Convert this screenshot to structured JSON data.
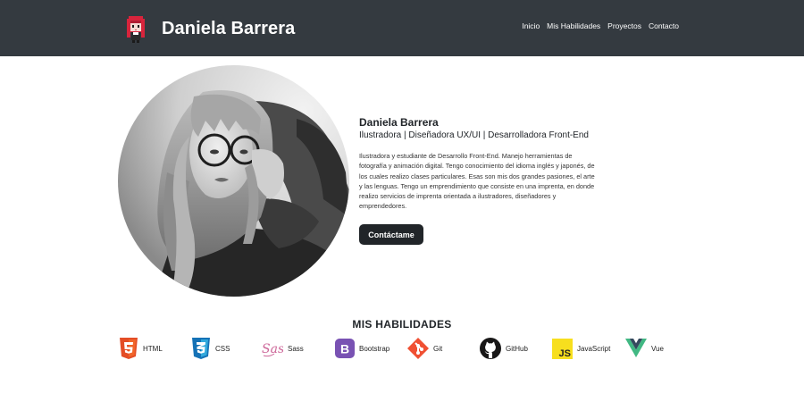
{
  "header": {
    "brand_name": "Daniela Barrera",
    "nav": [
      "Inicio",
      "Mis Habilidades",
      "Proyectos",
      "Contacto"
    ]
  },
  "profile": {
    "name": "Daniela Barrera",
    "role": "Ilustradora | Diseñadora UX/UI | Desarrolladora Front-End",
    "bio": "Ilustradora y estudiante de Desarrollo Front-End. Manejo herramientas de fotografía y animación digital. Tengo conocimiento del idioma inglés y japonés, de los cuales realizo clases particulares. Esas son mis dos grandes pasiones, el arte y las lenguas. Tengo un emprendimiento que consiste en una imprenta, en donde realizo servicios de imprenta orientada a ilustradores, diseñadores y emprendedores.",
    "contact_button": "Contáctame"
  },
  "skills": {
    "title": "MIS HABILIDADES",
    "items": [
      {
        "label": "HTML",
        "icon": "html5-icon",
        "color": "#e44d26"
      },
      {
        "label": "CSS",
        "icon": "css3-icon",
        "color": "#2965f1"
      },
      {
        "label": "Sass",
        "icon": "sass-icon",
        "color": "#cd6799"
      },
      {
        "label": "Bootstrap",
        "icon": "bootstrap-icon",
        "color": "#7952b3"
      },
      {
        "label": "Git",
        "icon": "git-icon",
        "color": "#f05033"
      },
      {
        "label": "GitHub",
        "icon": "github-icon",
        "color": "#181717"
      },
      {
        "label": "JavaScript",
        "icon": "javascript-icon",
        "color": "#f7df1e"
      },
      {
        "label": "Vue",
        "icon": "vue-icon",
        "color": "#41b883"
      }
    ]
  },
  "colors": {
    "navbar": "#343a40",
    "button": "#212529"
  }
}
